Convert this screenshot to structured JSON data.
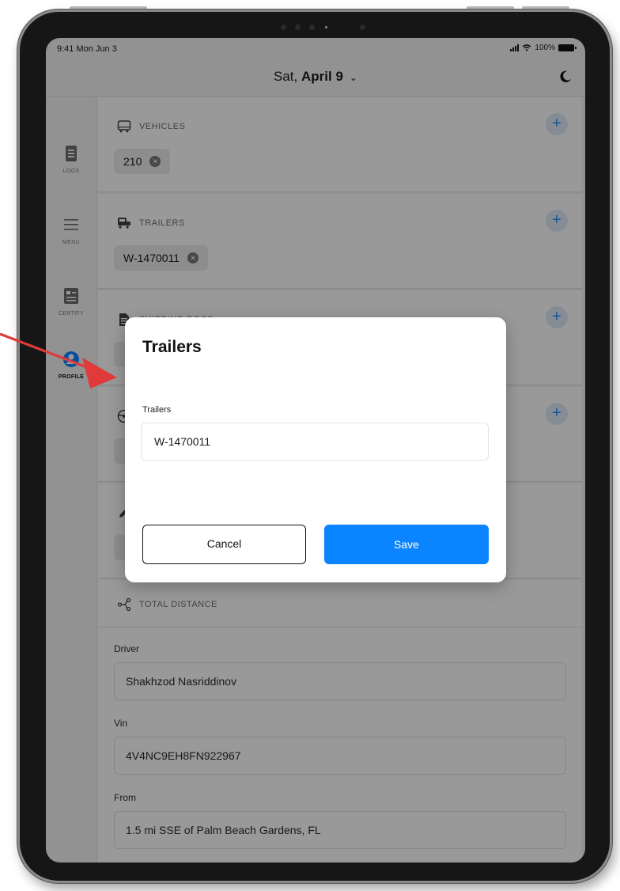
{
  "status_bar": {
    "time": "9:41 Mon Jun 3",
    "battery": "100%"
  },
  "header": {
    "weekday": "Sat,",
    "date": "April 9",
    "chevron": "⌄"
  },
  "sidebar": {
    "items": [
      {
        "label": "LOGS",
        "icon": "logs-icon"
      },
      {
        "label": "MENU",
        "icon": "menu-icon"
      },
      {
        "label": "CERTIFY",
        "icon": "certify-icon"
      },
      {
        "label": "PROFILE",
        "icon": "profile-icon",
        "active": true
      }
    ]
  },
  "sections": {
    "vehicles": {
      "title": "VEHICLES",
      "chip": "210"
    },
    "trailers": {
      "title": "TRAILERS",
      "chip": "W-1470011"
    },
    "shipping_docs": {
      "title": "SHIPPING DOCS"
    },
    "total_distance": {
      "title": "TOTAL DISTANCE"
    }
  },
  "form": {
    "driver_label": "Driver",
    "driver_value": "Shakhzod Nasriddinov",
    "vin_label": "Vin",
    "vin_value": "4V4NC9EH8FN922967",
    "from_label": "From",
    "from_value": "1.5 mi SSE of Palm Beach Gardens, FL"
  },
  "modal": {
    "title": "Trailers",
    "field_label": "Trailers",
    "field_value": "W-1470011",
    "cancel_label": "Cancel",
    "save_label": "Save"
  },
  "colors": {
    "accent": "#0a84ff",
    "annotation_arrow": "#e03a3a",
    "add_button_bg": "#dfeaf6"
  }
}
